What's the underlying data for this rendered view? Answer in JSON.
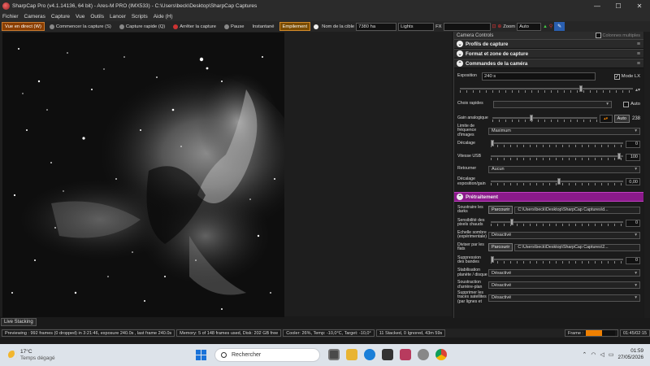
{
  "window": {
    "title": "SharpCap Pro (v4.1.14136, 64 bit) - Ares-M PRO (IMX533) - C:\\Users\\beck\\Desktop\\SharpCap Captures"
  },
  "menu": [
    "Fichier",
    "Cameras",
    "Capture",
    "Vue",
    "Outils",
    "Lancer",
    "Scripts",
    "Aide (H)"
  ],
  "toolbar": {
    "live_view": "Vue en direct (W)",
    "start_capture": "Commencer la capture (S)",
    "quick_capture": "Capture rapide (Q)",
    "stop_capture": "Arrêter la capture",
    "pause": "Pause",
    "snapshot": "Instantané",
    "stacking": "Empilement",
    "target_label": "Nom de la cible",
    "target_value": "7380 ha",
    "frame_type": "Lights",
    "fx_label": "FX",
    "fx_value": "",
    "zoom_label": "Zoom",
    "zoom_value": "Auto"
  },
  "panel": {
    "header": "Camera Controls",
    "multi_columns": "Colonnes multiples",
    "sections": {
      "profiles": "Profils de capture",
      "format": "Format et zone de capture",
      "camera": "Commandes de la caméra",
      "processing": "Prétraitement"
    },
    "camera": {
      "exposure_label": "Exposition",
      "exposure_value": "240 s",
      "lx_mode": "Mode LX",
      "quick_choice_label": "Choix rapides",
      "auto_label": "Auto",
      "gain_label": "Gain analogique",
      "gain_auto": "Auto",
      "gain_value": "238",
      "framerate_label": "Limite de fréquence d'images",
      "framerate_value": "Maximum",
      "offset_label": "Décalage",
      "offset_value": "0",
      "usb_label": "Vitesse USB",
      "usb_value": "100",
      "flip_label": "Retourner",
      "flip_value": "Aucun",
      "exp_offset_label": "Décalage exposition/gain",
      "exp_offset_value": "0,00"
    },
    "processing": {
      "darks_label": "Soustraire les darks",
      "browse": "Parcourir",
      "darks_path": "C:\\Users\\beck\\Desktop\\SharpCap Captures\\d...",
      "hot_pixels_label": "Sensibilité des pixels chauds",
      "hot_pixels_value": "0",
      "dark_scale_label": "Echelle sombre (expérimentale)",
      "dark_scale_value": "Désactivé",
      "flats_label": "Diviser par les flats",
      "flats_path": "C:\\Users\\beck\\Desktop\\SharpCap Captures\\2...",
      "banding_label": "Suppression des bandes",
      "banding_value": "0",
      "planet_stab_label": "Stabilisation planète / disque",
      "planet_stab_value": "Désactivé",
      "bg_sub_label": "Soustraction d'arrière-plan",
      "bg_sub_value": "Désactivé",
      "satellite_label": "Supprimer les traces satellites (par lignes et",
      "satellite_value": "Désactivé"
    }
  },
  "live_stacking_tab": "Live Stacking",
  "status": {
    "preview": "Previewing : 992 frames (0 dropped) in 3:21:46, exposure 240.0s , last frame 240.0s",
    "memory": "Memory: 5 of 148 frames used, Disk: 202 GB free",
    "cooler": "Cooler: 26%, Temp: -10,0°C, Target: -10,0°",
    "stacked": "11 Stacked, 0 Ignored, 43m 59s",
    "frame_label": "Frame :",
    "frame_progress": 0.55,
    "time": "01:45/02:15"
  },
  "taskbar": {
    "temperature": "17°C",
    "weather": "Temps dégagé",
    "search_placeholder": "Rechercher",
    "clock_time": "01:59",
    "clock_date": "27/05/2026"
  },
  "colors": {
    "accent_orange": "#f08000",
    "processing_magenta": "#8b1a8b"
  }
}
